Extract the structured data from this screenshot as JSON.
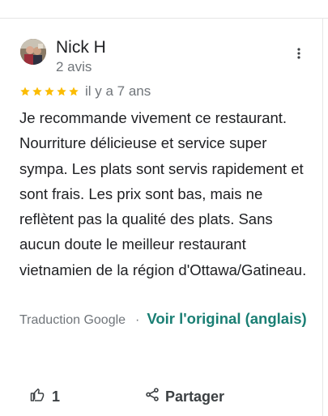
{
  "review": {
    "author_name": "Nick H",
    "author_meta": "2 avis",
    "rating": 5,
    "rating_max": 5,
    "time_ago": "il y a 7 ans",
    "text": "Je recommande vivement ce restaurant. Nourriture délicieuse et service super sympa. Les plats sont servis rapidement et sont frais. Les prix sont bas, mais ne reflètent pas la qualité des plats. Sans aucun doute le meilleur restaurant vietnamien de la région d'Ottawa/Gatineau.",
    "translated_by": "Traduction Google",
    "separator": "·",
    "see_original": "Voir l'original (anglais)"
  },
  "actions": {
    "like_count": "1",
    "share_label": "Partager"
  },
  "icons": {
    "more": "more-vert-icon",
    "star": "star-icon",
    "like": "thumb-up-icon",
    "share": "share-icon"
  },
  "colors": {
    "star": "#fbbc04",
    "link": "#1a7f74",
    "secondary_text": "#70757a",
    "primary_text": "#202124"
  }
}
